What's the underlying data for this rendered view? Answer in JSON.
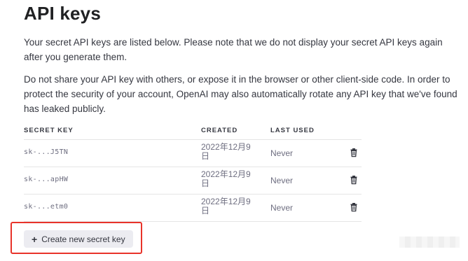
{
  "page": {
    "title": "API keys",
    "description_1": "Your secret API keys are listed below. Please note that we do not display your secret API keys again after you generate them.",
    "description_2": "Do not share your API key with others, or expose it in the browser or other client-side code. In order to protect the security of your account, OpenAI may also automatically rotate any API key that we've found has leaked publicly."
  },
  "table": {
    "headers": {
      "secret_key": "SECRET KEY",
      "created": "CREATED",
      "last_used": "LAST USED"
    },
    "rows": [
      {
        "key": "sk-...J5TN",
        "created": "2022年12月9日",
        "last_used": "Never"
      },
      {
        "key": "sk-...apHW",
        "created": "2022年12月9日",
        "last_used": "Never"
      },
      {
        "key": "sk-...etm0",
        "created": "2022年12月9日",
        "last_used": "Never"
      }
    ]
  },
  "actions": {
    "create_label": "Create new secret key",
    "delete_icon": "trash-icon",
    "create_icon": "plus-icon"
  },
  "colors": {
    "highlight": "#e8332a",
    "button_bg": "#ececf1",
    "text": "#353740",
    "muted": "#6e6e80"
  }
}
